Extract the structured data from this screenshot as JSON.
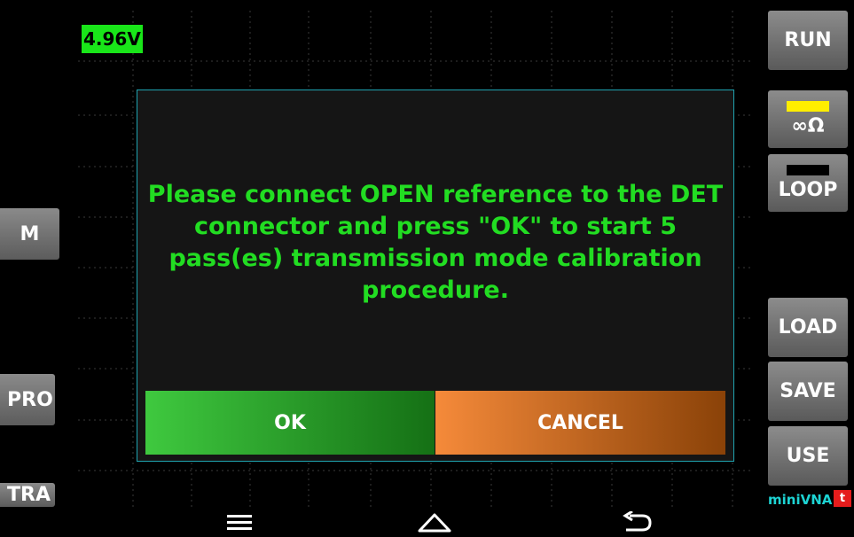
{
  "status": {
    "voltage": "4.96V"
  },
  "left_buttons": {
    "m": "M",
    "pro": "PRO",
    "tra": "TRA"
  },
  "right_buttons": {
    "run": "RUN",
    "infinite_ohm": "∞Ω",
    "loop": "LOOP",
    "load": "LOAD",
    "save": "SAVE",
    "use": "USE"
  },
  "brand": {
    "name": "miniVNA",
    "mark": "t"
  },
  "dialog": {
    "message": "Please connect OPEN reference to the DET connector and press \"OK\" to start 5 pass(es) transmission mode calibration procedure.",
    "ok_label": "OK",
    "cancel_label": "CANCEL"
  },
  "colors": {
    "voltage_bg": "#19e619",
    "message_text": "#22dd22",
    "ok_button": "#3fc93f",
    "cancel_button": "#f58a3a",
    "dialog_border": "#1fa3b0",
    "indicator_inf": "#ffee00",
    "brand_text": "#1dd3d3"
  },
  "navbar": {
    "icons": [
      "menu-icon",
      "home-icon",
      "back-icon"
    ]
  }
}
